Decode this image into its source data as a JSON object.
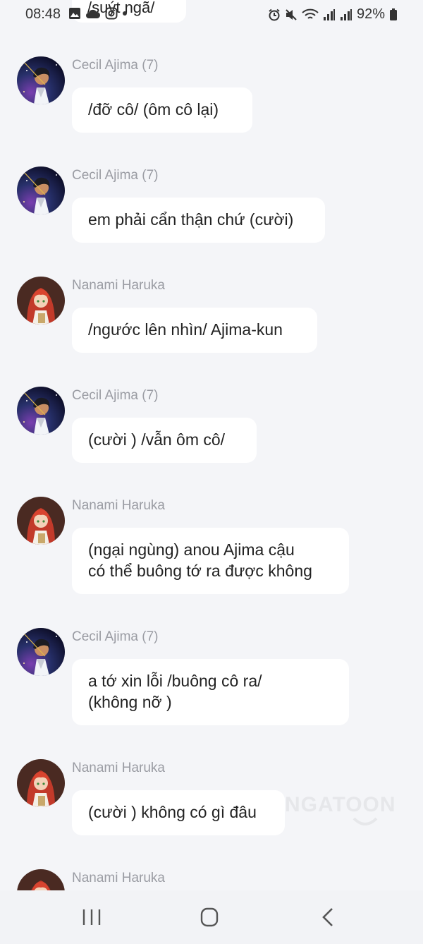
{
  "status_bar": {
    "time": "08:48",
    "battery": "92%",
    "left_icons": [
      "image-icon",
      "cloud-icon",
      "instagram-icon",
      "dot-icon"
    ],
    "right_icons": [
      "alarm-icon",
      "mute-icon",
      "wifi-icon",
      "signal-icon",
      "signal-icon",
      "battery-icon"
    ]
  },
  "top_partial_message": "/suýt ngã/",
  "messages": [
    {
      "sender": "Cecil Ajima (7)",
      "text": "/đỡ cô/ (ôm cô lại)",
      "avatar": "cecil"
    },
    {
      "sender": "Cecil Ajima (7)",
      "text": "em phải cẩn thận chứ (cười)",
      "avatar": "cecil"
    },
    {
      "sender": "Nanami Haruka",
      "text": "/ngước lên nhìn/ Ajima-kun",
      "avatar": "nanami"
    },
    {
      "sender": "Cecil Ajima (7)",
      "text": "(cười ) /vẫn ôm cô/",
      "avatar": "cecil"
    },
    {
      "sender": "Nanami Haruka",
      "text": "(ngại ngùng) anou Ajima cậu\ncó thể buông tớ ra được không",
      "avatar": "nanami"
    },
    {
      "sender": "Cecil Ajima (7)",
      "text": "a tớ xin lỗi /buông cô ra/\n(không nỡ )",
      "avatar": "cecil"
    },
    {
      "sender": "Nanami Haruka",
      "text": "(cười ) không có gì đâu",
      "avatar": "nanami"
    },
    {
      "sender": "Nanami Haruka",
      "text": "",
      "avatar": "nanami"
    }
  ],
  "watermark": "NGATOON",
  "nav_bar": {
    "buttons": [
      "recent-apps",
      "home",
      "back"
    ]
  },
  "colors": {
    "background": "#f4f5f8",
    "bubble": "#ffffff",
    "sender": "#9a9ca3",
    "text": "#222222"
  }
}
